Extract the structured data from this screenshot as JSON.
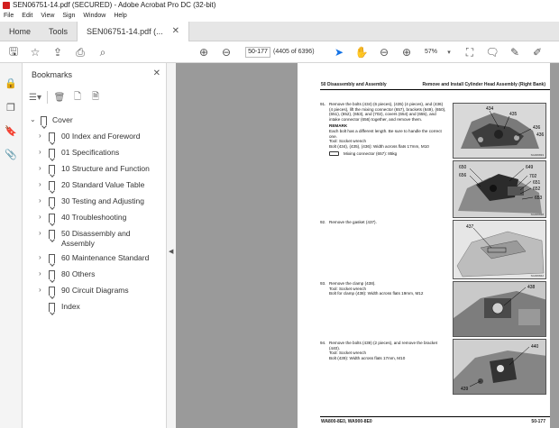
{
  "window": {
    "title": "SEN06751-14.pdf (SECURED) - Adobe Acrobat Pro DC (32-bit)"
  },
  "menu": [
    "File",
    "Edit",
    "View",
    "Sign",
    "Window",
    "Help"
  ],
  "tabs": {
    "home": "Home",
    "tools": "Tools",
    "document": "SEN06751-14.pdf (..."
  },
  "toolbar": {
    "page_value": "50-177",
    "page_count": "(4405 of 6396)",
    "zoom": "57%"
  },
  "bookmarks": {
    "title": "Bookmarks",
    "items": [
      {
        "label": "Cover",
        "level": 0
      },
      {
        "label": "00 Index and Foreword",
        "level": 1
      },
      {
        "label": "01 Specifications",
        "level": 1
      },
      {
        "label": "10 Structure and Function",
        "level": 1
      },
      {
        "label": "20 Standard Value Table",
        "level": 1
      },
      {
        "label": "30 Testing and Adjusting",
        "level": 1
      },
      {
        "label": "40 Troubleshooting",
        "level": 1
      },
      {
        "label": "50 Disassembly and Assembly",
        "level": 1
      },
      {
        "label": "60 Maintenance Standard",
        "level": 1
      },
      {
        "label": "80 Others",
        "level": 1
      },
      {
        "label": "90 Circuit Diagrams",
        "level": 1
      },
      {
        "label": "Index",
        "level": 1
      }
    ]
  },
  "page": {
    "header_left": "50 Disassembly and Assembly",
    "header_right": "Remove and Install Cylinder Head Assembly (Right Bank)",
    "footer_left": "WA800-8E0, WA900-8E0",
    "footer_right": "50-177",
    "steps": [
      {
        "num": "91.",
        "text": "Remove the bolts (434) (6 pieces), (435) (4 pieces), and (436) (4 pieces), lift the mixing connector (657), brackets (649), (650), (651), (652), (653), and (702), covers (654) and (655), and intake connector (656) together, and remove them.",
        "remark_title": "REMARK",
        "remark": "Each bolt has a different length. Be sure to handle the correct one.",
        "tool": "Tool: Socket wrench",
        "bolt": "Bolt (434), (435), (436): Width across flats 17mm, M10",
        "weight": "Mixing connector (657): 85kg"
      },
      {
        "num": "92.",
        "text": "Remove the gasket (437)."
      },
      {
        "num": "93.",
        "text": "Remove the clamp (438).",
        "tool": "Tool: Socket wrench",
        "bolt": "Bolt for clamp (438): Width across flats 19mm, M12"
      },
      {
        "num": "94.",
        "text": "Remove the bolts (439) (2 pieces), and remove the bracket (440).",
        "tool": "Tool: Socket wrench",
        "bolt": "Bolt (439): Width across flats 17mm, M10"
      }
    ],
    "figures": {
      "fig1": {
        "callouts": [
          "434",
          "435",
          "436",
          "436"
        ],
        "code": "SG006833"
      },
      "fig2": {
        "callouts": [
          "650",
          "649",
          "656",
          "702",
          "651",
          "652",
          "653"
        ],
        "code": "SG006838"
      },
      "fig3": {
        "callouts": [
          "437"
        ],
        "code": "SG006842"
      },
      "fig4": {
        "callouts": [
          "438"
        ]
      },
      "fig5": {
        "callouts": [
          "440",
          "439"
        ]
      }
    }
  }
}
